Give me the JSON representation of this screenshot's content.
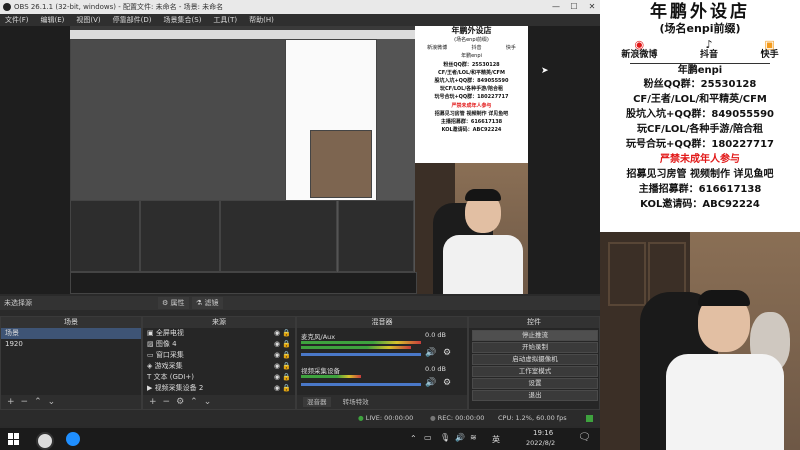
{
  "window": {
    "title": "OBS 26.1.1 (32-bit, windows) - 配置文件: 未命名 - 场景: 未命名",
    "min": "—",
    "max": "☐",
    "close": "✕"
  },
  "menu": [
    "文件(F)",
    "编辑(E)",
    "视图(V)",
    "停靠部件(D)",
    "场景集合(S)",
    "工具(T)",
    "帮助(H)"
  ],
  "source_toolbar": {
    "label": "未选择源",
    "properties": "属性",
    "filters": "滤镜"
  },
  "docks": {
    "scenes": {
      "title": "场景",
      "items": [
        "场景",
        "1920"
      ]
    },
    "sources": {
      "title": "来源",
      "items": [
        "全屏电视",
        "图像 4",
        "窗口采集",
        "游戏采集",
        "文本 (GDI+)",
        "视频采集设备 2"
      ]
    },
    "mixer": {
      "title": "混音器",
      "channels": [
        {
          "name": "麦克风/Aux",
          "db": "0.0 dB"
        },
        {
          "name": "视频采集设备",
          "db": "0.0 dB"
        }
      ],
      "tabs": [
        "混音器",
        "转场特效"
      ]
    },
    "controls": {
      "title": "控件",
      "buttons": [
        "停止推流",
        "开始录制",
        "启动虚拟摄像机",
        "工作室模式",
        "设置",
        "退出"
      ]
    }
  },
  "status": {
    "live": "LIVE: 00:00:00",
    "rec": "REC: 00:00:00",
    "cpu": "CPU: 1.2%, 60.00 fps"
  },
  "taskbar": {
    "ime": "英",
    "time": "19:16",
    "date": "2022/8/2"
  },
  "poster": {
    "title": "年鹏外设店",
    "subtitle": "(场名enpi前缀)",
    "social": [
      "新浪微博",
      "抖音",
      "快手"
    ],
    "nick": "年鹏enpi",
    "lines": [
      {
        "text": "粉丝QQ群：25530128",
        "red": false
      },
      {
        "text": "CF/王者/LOL/和平精英/CFM",
        "red": false
      },
      {
        "text": "股坑入坑+QQ群：849055590",
        "red": false,
        "red_part": "849055590"
      },
      {
        "text": "玩CF/LOL/各种手游/陪合租",
        "red": false
      },
      {
        "text": "玩号合玩+QQ群：180227717",
        "red": false,
        "red_part": "180227717"
      },
      {
        "text": "严禁未成年人参与",
        "red": true
      },
      {
        "text": "招募见习房管 视频制作 详见鱼吧",
        "red": false,
        "mixed": true
      },
      {
        "text": "主播招募群：616617138",
        "red": false
      },
      {
        "text": "KOL邀请码：ABC92224",
        "red": false
      }
    ]
  },
  "colors": {
    "accent_blue": "#3e5475",
    "promo_red": "#e21818",
    "live_green": "#3ea23e"
  }
}
